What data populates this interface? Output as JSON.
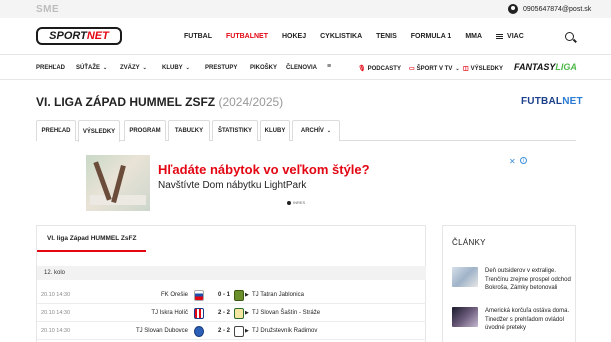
{
  "topbar": {
    "site": "SME",
    "email": "0905647874@post.sk"
  },
  "mainnav": {
    "logo_a": "SPORT",
    "logo_b": "NET",
    "links": [
      "FUTBAL",
      "FUTBALNET",
      "HOKEJ",
      "CYKLISTIKA",
      "TENIS",
      "FORMULA 1",
      "MMA"
    ],
    "more": "VIAC"
  },
  "subnav": {
    "items": [
      "PREHĽAD",
      "SÚŤAŽE",
      "ZVÄZY",
      "KLUBY",
      "PRESTUPY",
      "PIKOŠKY",
      "ČLENOVIA"
    ],
    "podcasts": "PODCASTY",
    "tv": "ŠPORT V TV",
    "results": "VÝSLEDKY",
    "fantasy_a": "FANTASY",
    "fantasy_b": "LIGA"
  },
  "league": {
    "title": "VI. LIGA ZÁPAD HUMMEL ZSFZ",
    "season": "(2024/2025)",
    "brand_a": "FUTBAL",
    "brand_b": "NET"
  },
  "tabs": [
    "PREHĽAD",
    "VÝSLEDKY",
    "PROGRAM",
    "TABUĽKY",
    "ŠTATISTIKY",
    "KLUBY",
    "ARCHÍV"
  ],
  "ad": {
    "title": "Hľadáte nábytok vo veľkom štýle?",
    "text": "Navštívte Dom nábytku LightPark",
    "brand": "INRES"
  },
  "results": {
    "tab": "VI. liga Západ HUMMEL ZsFZ",
    "round": "12. kolo",
    "matches": [
      {
        "datetime": "20.10 14:30",
        "home": "FK Orešie",
        "score": "0 - 1",
        "away": "TJ Tatran Jablonica"
      },
      {
        "datetime": "20.10 14:30",
        "home": "TJ Iskra Holíč",
        "score": "2 - 2",
        "away": "TJ Slovan Šaštín - Stráže"
      },
      {
        "datetime": "20.10 14:30",
        "home": "TJ Slovan Dubovce",
        "score": "2 - 2",
        "away": "TJ Družstevník Radimov"
      }
    ]
  },
  "sidebar": {
    "title": "ČLÁNKY",
    "articles": [
      {
        "text": "Deň outsiderov v extralige. Trenčínu zrejme prospel odchod Bokroša, Zámky betonovali"
      },
      {
        "text": "Americká korčuľa ostáva doma. Tinedžer s prehľadom ovládol úvodné preteky"
      }
    ]
  },
  "colors": {
    "accent": "#e30613",
    "link_blue": "#2a7bd4",
    "fantasy_green": "#4db848"
  }
}
